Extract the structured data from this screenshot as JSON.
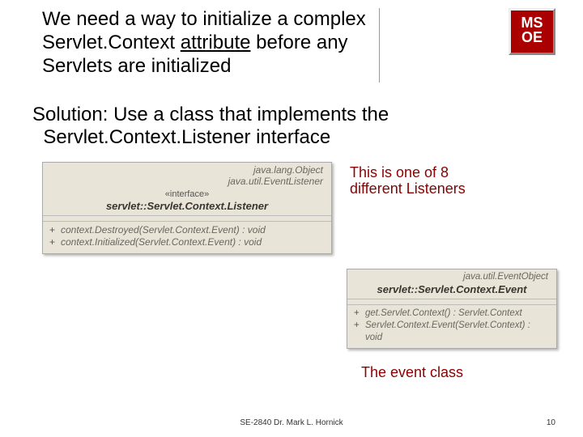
{
  "logo": {
    "line1": "MS",
    "line2": "OE"
  },
  "title": {
    "t1": "We need a way to initialize a complex ",
    "t2": "Servlet.Context",
    "t3": " ",
    "t4": "attribute",
    "t5": " before any Servlets are initialized"
  },
  "solution": {
    "s1": "Solution: Use a class that implements the ",
    "s2": "Servlet.Context.Listener",
    "s3": " interface"
  },
  "uml1": {
    "parent1": "java.lang.Object",
    "parent2": "java.util.EventListener",
    "stereo": "«interface»",
    "name": "servlet::Servlet.Context.Listener",
    "op1": "context.Destroyed(Servlet.Context.Event) : void",
    "op2": "context.Initialized(Servlet.Context.Event) : void"
  },
  "uml2": {
    "parent1": "java.util.EventObject",
    "name": "servlet::Servlet.Context.Event",
    "op1": "get.Servlet.Context() : Servlet.Context",
    "op2": "Servlet.Context.Event(Servlet.Context) : void"
  },
  "annot1_l1": "This is one of 8",
  "annot1_l2": "different Listeners",
  "annot2": "The event class",
  "footer": "SE-2840 Dr. Mark L. Hornick",
  "pagenum": "10"
}
